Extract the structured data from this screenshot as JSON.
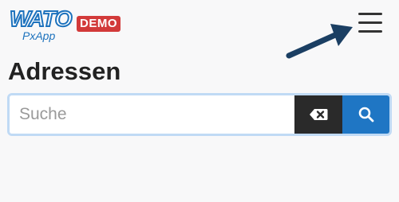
{
  "header": {
    "logo_main": "WATO",
    "logo_sub": "PxApp",
    "badge": "DEMO",
    "menu_icon": "hamburger-menu-icon",
    "arrow_icon": "pointer-arrow-icon"
  },
  "page": {
    "title": "Adressen"
  },
  "search": {
    "placeholder": "Suche",
    "value": "",
    "clear_icon": "backspace-clear-icon",
    "search_icon": "search-icon"
  },
  "colors": {
    "brand_blue": "#1f76c4",
    "badge_red": "#d23a3a",
    "arrow_navy": "#1b3f63",
    "dark_button": "#2a2a2a"
  }
}
